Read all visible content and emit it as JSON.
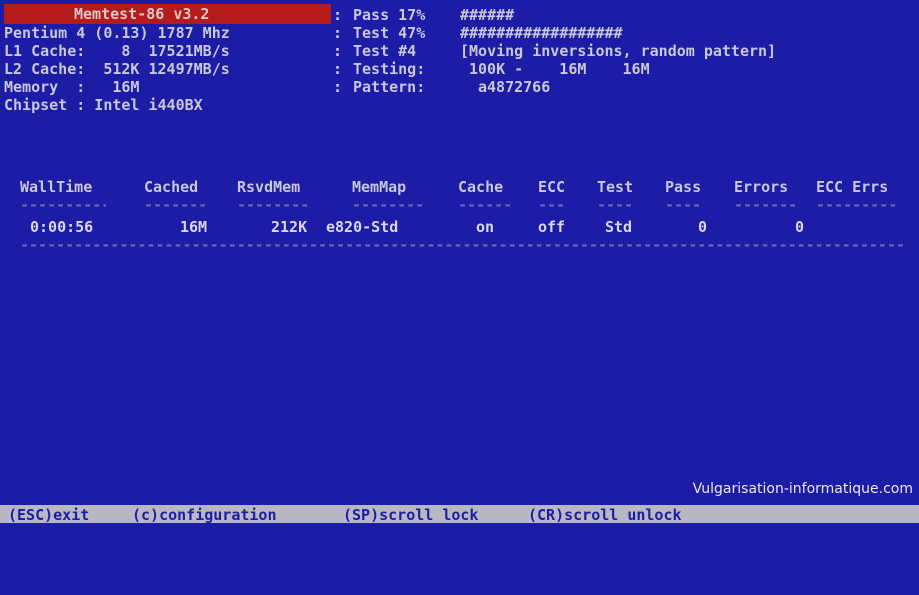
{
  "header": {
    "title": "Memtest-86 v3.2",
    "cpu": "Pentium 4 (0.13) 1787 Mhz",
    "l1": "L1 Cache:    8  17521MB/s",
    "l2": "L2 Cache:  512K 12497MB/s",
    "memory": "Memory  :   16M",
    "chipset": "Chipset : Intel i440BX"
  },
  "status": {
    "pass_line": "Pass 17%",
    "pass_bar": "######",
    "test_line": "Test 47%",
    "test_bar": "##################",
    "test_num": "Test #4",
    "test_desc": "[Moving inversions, random pattern]",
    "testing_label": "Testing:",
    "testing_value": "100K -    16M    16M",
    "pattern_label": "Pattern:",
    "pattern_value": "a4872766"
  },
  "table": {
    "headers": [
      "WallTime",
      "Cached",
      "RsvdMem",
      "MemMap",
      "Cache",
      "ECC",
      "Test",
      "Pass",
      "Errors",
      "ECC Errs"
    ],
    "row": [
      "0:00:56",
      "16M",
      "212K",
      "e820-Std",
      "on",
      "off",
      "Std",
      "0",
      "0"
    ]
  },
  "watermark": "Vulgarisation-informatique.com",
  "footer": {
    "esc": "(ESC)exit",
    "config": "(c)configuration",
    "sp": "(SP)scroll lock",
    "cr": "(CR)scroll unlock"
  },
  "colors": {
    "background": "#1c1ca6",
    "title_bar": "#b51b1b",
    "footer_bar": "#b8b8c4"
  }
}
